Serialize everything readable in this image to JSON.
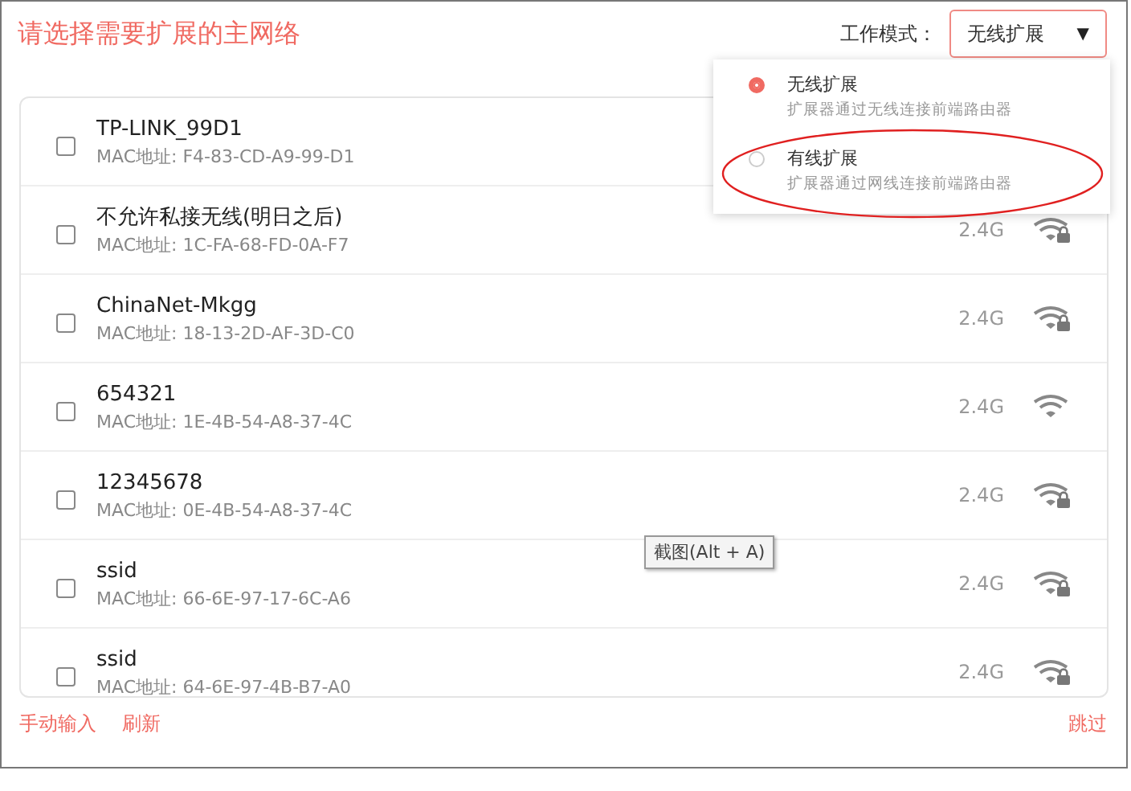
{
  "title": "请选择需要扩展的主网络",
  "mode": {
    "label": "工作模式：",
    "value": "无线扩展",
    "caret": "▼"
  },
  "mode_menu": [
    {
      "label": "无线扩展",
      "description": "扩展器通过无线连接前端路由器",
      "selected": true,
      "circled": false
    },
    {
      "label": "有线扩展",
      "description": "扩展器通过网线连接前端路由器",
      "selected": false,
      "circled": true
    }
  ],
  "networks": [
    {
      "name": "TP-LINK_99D1",
      "mac": "MAC地址: F4-83-CD-A9-99-D1",
      "checked": false
    },
    {
      "name": "不允许私接无线(明日之后)",
      "mac": "MAC地址: 1C-FA-68-FD-0A-F7",
      "checked": false,
      "band": "2.4G",
      "secured": true
    },
    {
      "name": "ChinaNet-Mkgg",
      "mac": "MAC地址: 18-13-2D-AF-3D-C0",
      "checked": false,
      "band": "2.4G",
      "secured": true
    },
    {
      "name": "654321",
      "mac": "MAC地址: 1E-4B-54-A8-37-4C",
      "checked": false,
      "band": "2.4G",
      "secured": false
    },
    {
      "name": "12345678",
      "mac": "MAC地址: 0E-4B-54-A8-37-4C",
      "checked": false,
      "band": "2.4G",
      "secured": true
    },
    {
      "name": "ssid",
      "mac": "MAC地址: 66-6E-97-17-6C-A6",
      "checked": false,
      "band": "2.4G",
      "secured": true
    },
    {
      "name": "ssid",
      "mac": "MAC地址: 64-6E-97-4B-B7-A0",
      "checked": false,
      "band": "2.4G",
      "secured": true
    }
  ],
  "tooltip": "截图(Alt + A)",
  "footer_links": [
    "手动输入",
    "刷新"
  ],
  "skip": "跳过"
}
